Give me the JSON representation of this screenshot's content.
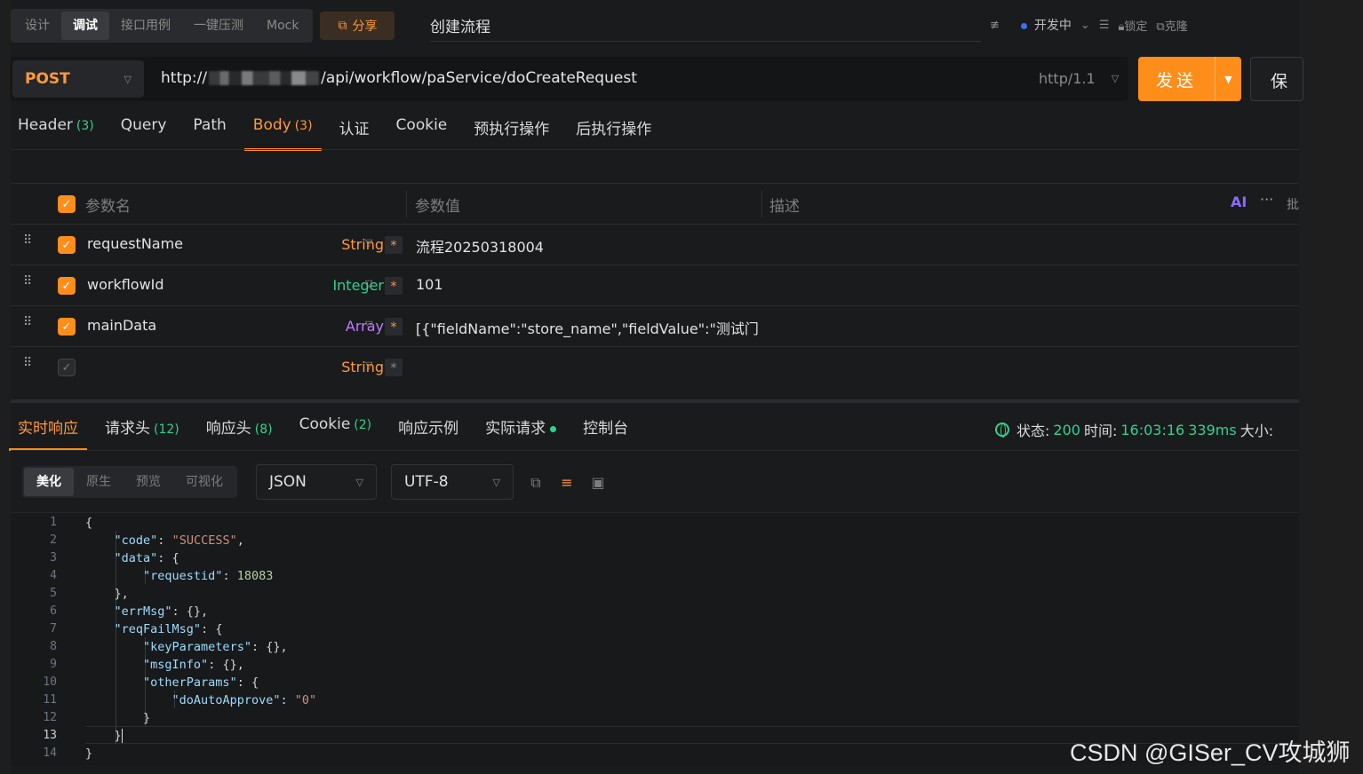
{
  "top": {
    "mode_tabs": [
      "设计",
      "调试",
      "接口用例",
      "一键压测",
      "Mock"
    ],
    "share_label": "分享",
    "title": "创建流程",
    "env_label": "开发中",
    "lock_label": "锁定",
    "clone_label": "克隆"
  },
  "request": {
    "method": "POST",
    "url_prefix": "http://",
    "url_path": "/api/workflow/paService/doCreateRequest",
    "protocol": "http/1.1",
    "send_label": "发送",
    "save_label": "保"
  },
  "req_tabs": [
    {
      "label": "Header",
      "count": "(3)"
    },
    {
      "label": "Query",
      "count": ""
    },
    {
      "label": "Path",
      "count": ""
    },
    {
      "label": "Body",
      "count": "(3)"
    },
    {
      "label": "认证",
      "count": ""
    },
    {
      "label": "Cookie",
      "count": ""
    },
    {
      "label": "预执行操作",
      "count": ""
    },
    {
      "label": "后执行操作",
      "count": ""
    }
  ],
  "params": {
    "headers": {
      "name": "参数名",
      "value": "参数值",
      "desc": "描述",
      "ai": "AI",
      "batch": "批"
    },
    "rows": [
      {
        "name": "requestName",
        "type": "String",
        "value": "流程20250318004"
      },
      {
        "name": "workflowId",
        "type": "Integer",
        "value": "101"
      },
      {
        "name": "mainData",
        "type": "Array",
        "value": "[{\"fieldName\":\"store_name\",\"fieldValue\":\"测试门"
      },
      {
        "name": "",
        "type": "String",
        "value": ""
      }
    ],
    "required_mark": "*"
  },
  "resp_tabs": [
    {
      "label": "实时响应",
      "count": ""
    },
    {
      "label": "请求头",
      "count": "(12)"
    },
    {
      "label": "响应头",
      "count": "(8)"
    },
    {
      "label": "Cookie",
      "count": "(2)"
    },
    {
      "label": "响应示例",
      "count": ""
    },
    {
      "label": "实际请求",
      "count": ""
    },
    {
      "label": "控制台",
      "count": ""
    }
  ],
  "status": {
    "status_label": "状态:",
    "status_value": "200",
    "time_label": "时间:",
    "time_value": "16:03:16",
    "duration": "339ms",
    "size_label": "大小:"
  },
  "view_tabs": [
    "美化",
    "原生",
    "预览",
    "可视化"
  ],
  "format_select": "JSON",
  "encoding_select": "UTF-8",
  "code_lines": [
    "{",
    "    \"code\": \"SUCCESS\",",
    "    \"data\": {",
    "        \"requestid\": 18083",
    "    },",
    "    \"errMsg\": {},",
    "    \"reqFailMsg\": {",
    "        \"keyParameters\": {},",
    "        \"msgInfo\": {},",
    "        \"otherParams\": {",
    "            \"doAutoApprove\": \"0\"",
    "        }",
    "    }",
    "}"
  ],
  "line_numbers": [
    "1",
    "2",
    "3",
    "4",
    "5",
    "6",
    "7",
    "8",
    "9",
    "10",
    "11",
    "12",
    "13",
    "14"
  ],
  "watermark": "CSDN @GISer_CV攻城狮",
  "colors": {
    "accent": "#ff8d1a",
    "green": "#2fd38d",
    "purple": "#c07bff"
  }
}
